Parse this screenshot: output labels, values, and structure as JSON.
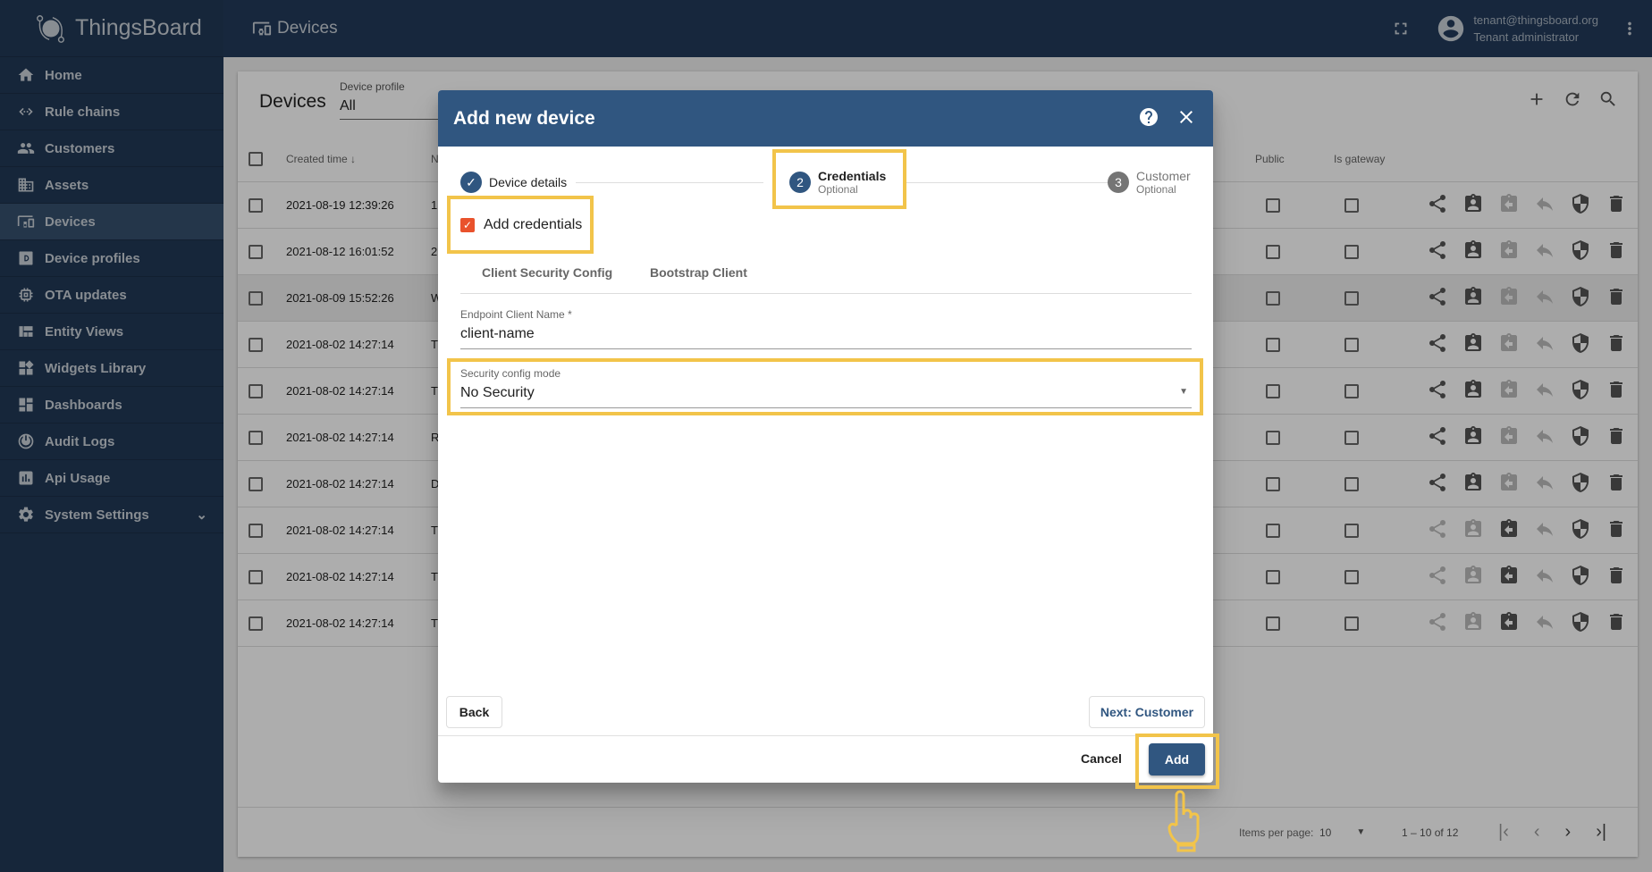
{
  "app": {
    "name": "ThingsBoard"
  },
  "sidebar": {
    "items": [
      {
        "label": "Home",
        "icon": "home-icon"
      },
      {
        "label": "Rule chains",
        "icon": "rule-chains-icon"
      },
      {
        "label": "Customers",
        "icon": "customers-icon"
      },
      {
        "label": "Assets",
        "icon": "assets-icon"
      },
      {
        "label": "Devices",
        "icon": "devices-icon",
        "active": true
      },
      {
        "label": "Device profiles",
        "icon": "device-profiles-icon"
      },
      {
        "label": "OTA updates",
        "icon": "ota-icon"
      },
      {
        "label": "Entity Views",
        "icon": "entity-views-icon"
      },
      {
        "label": "Widgets Library",
        "icon": "widgets-icon"
      },
      {
        "label": "Dashboards",
        "icon": "dashboards-icon"
      },
      {
        "label": "Audit Logs",
        "icon": "audit-logs-icon"
      },
      {
        "label": "Api Usage",
        "icon": "api-usage-icon"
      },
      {
        "label": "System Settings",
        "icon": "settings-icon",
        "expandable": true
      }
    ]
  },
  "header": {
    "title": "Devices",
    "user_email": "tenant@thingsboard.org",
    "user_role": "Tenant administrator"
  },
  "card": {
    "title": "Devices",
    "profile_label": "Device profile",
    "profile_value": "All",
    "columns": {
      "created_time": "Created time",
      "name": "N",
      "public": "Public",
      "is_gateway": "Is gateway"
    },
    "rows": [
      {
        "created": "2021-08-19 12:39:26",
        "name": "1",
        "assigned": false
      },
      {
        "created": "2021-08-12 16:01:52",
        "name": "2",
        "assigned": false
      },
      {
        "created": "2021-08-09 15:52:26",
        "name": "W",
        "assigned": false,
        "highlight": true
      },
      {
        "created": "2021-08-02 14:27:14",
        "name": "T",
        "assigned": false
      },
      {
        "created": "2021-08-02 14:27:14",
        "name": "T",
        "assigned": false
      },
      {
        "created": "2021-08-02 14:27:14",
        "name": "R",
        "assigned": false
      },
      {
        "created": "2021-08-02 14:27:14",
        "name": "D",
        "assigned": false
      },
      {
        "created": "2021-08-02 14:27:14",
        "name": "T",
        "assigned": true
      },
      {
        "created": "2021-08-02 14:27:14",
        "name": "T",
        "assigned": true
      },
      {
        "created": "2021-08-02 14:27:14",
        "name": "T",
        "assigned": true
      }
    ],
    "pager": {
      "items_per_page_label": "Items per page:",
      "items_per_page": "10",
      "range": "1 – 10 of 12"
    }
  },
  "dialog": {
    "title": "Add new device",
    "steps": [
      {
        "num": "1",
        "label": "Device details",
        "sub": "",
        "state": "done"
      },
      {
        "num": "2",
        "label": "Credentials",
        "sub": "Optional",
        "state": "active"
      },
      {
        "num": "3",
        "label": "Customer",
        "sub": "Optional",
        "state": "pending"
      }
    ],
    "add_credentials_label": "Add credentials",
    "add_credentials_checked": true,
    "tabs": [
      "Client Security Config",
      "Bootstrap Client"
    ],
    "endpoint_label": "Endpoint Client Name *",
    "endpoint_value": "client-name",
    "security_label": "Security config mode",
    "security_value": "No Security",
    "back_label": "Back",
    "next_label": "Next: Customer",
    "cancel_label": "Cancel",
    "add_label": "Add"
  },
  "colors": {
    "primary": "#305680",
    "sidebar": "#213856",
    "highlight": "#f2c44a",
    "checkbox": "#e9522c"
  }
}
